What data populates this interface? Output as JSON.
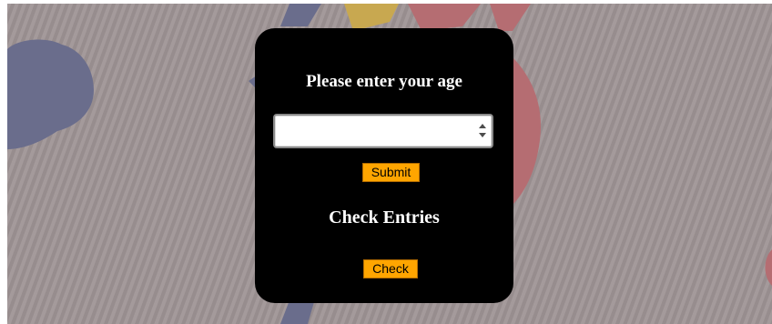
{
  "form": {
    "age_heading": "Please enter your age",
    "age_input_value": "",
    "age_input_placeholder": "",
    "submit_label": "Submit",
    "check_heading": "Check Entries",
    "check_label": "Check"
  },
  "colors": {
    "card_background": "#000000",
    "button_background": "#ffa500",
    "page_background": "#9b9293",
    "heading_text": "#ffffff"
  },
  "icons": {
    "spinner_up": "triangle-up-icon",
    "spinner_down": "triangle-down-icon"
  }
}
